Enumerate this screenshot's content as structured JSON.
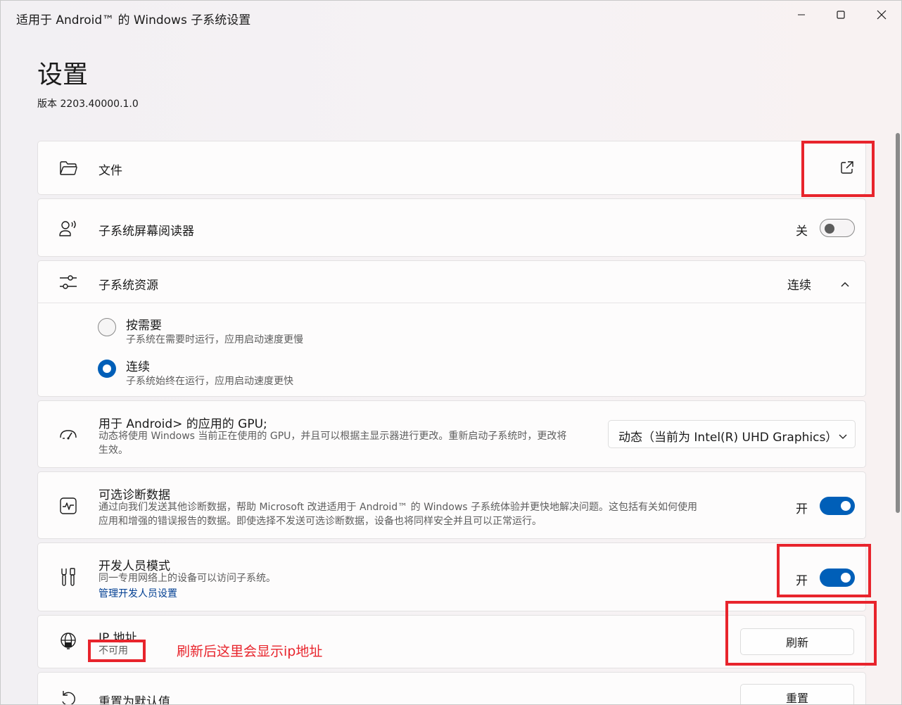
{
  "window": {
    "title": "适用于 Android™ 的 Windows 子系统设置",
    "minimize_icon": "minimize-icon",
    "maximize_icon": "maximize-icon",
    "close_icon": "close-icon"
  },
  "page": {
    "title": "设置",
    "version": "版本 2203.40000.1.0"
  },
  "files": {
    "icon": "folder-icon",
    "label": "文件",
    "action_icon": "open-external-icon"
  },
  "screen_reader": {
    "icon": "screen-reader-icon",
    "label": "子系统屏幕阅读器",
    "state": "关",
    "enabled": false
  },
  "resources": {
    "icon": "sliders-icon",
    "label": "子系统资源",
    "value": "连续",
    "expanded": true,
    "options": [
      {
        "label": "按需要",
        "desc": "子系统在需要时运行，应用启动速度更慢",
        "selected": false
      },
      {
        "label": "连续",
        "desc": "子系统始终在运行，应用启动速度更快",
        "selected": true
      }
    ]
  },
  "gpu": {
    "icon": "gauge-icon",
    "label": "用于 Android> 的应用的 GPU;",
    "desc_line1": "动态将使用 Windows 当前正在使用的 GPU，并且可以根据主显示器进行更改。重新启动子系统时，更改将",
    "desc_line2": "生效。",
    "selected": "动态（当前为 Intel(R) UHD Graphics）"
  },
  "diagnostics": {
    "icon": "activity-icon",
    "label": "可选诊断数据",
    "desc_line1": "通过向我们发送其他诊断数据，帮助 Microsoft 改进适用于 Android™ 的 Windows 子系统体验并更快地解决问题。这包括有关如何使用",
    "desc_line2": "应用和增强的错误报告的数据。即使选择不发送可选诊断数据，设备也将同样安全并且可以正常运行。",
    "state": "开",
    "enabled": true
  },
  "developer": {
    "icon": "tools-icon",
    "label": "开发人员模式",
    "desc": "同一专用网络上的设备可以访问子系统。",
    "link": "管理开发人员设置",
    "state": "开",
    "enabled": true
  },
  "ip": {
    "icon": "globe-icon",
    "label": "IP 地址",
    "value": "不可用",
    "button": "刷新"
  },
  "reset": {
    "icon": "reset-icon",
    "label": "重置为默认值",
    "button": "重置"
  },
  "annotations": {
    "note": "刷新后这里会显示ip地址",
    "color": "#e8242c"
  },
  "colors": {
    "accent": "#005fb8",
    "link": "#003e92"
  }
}
